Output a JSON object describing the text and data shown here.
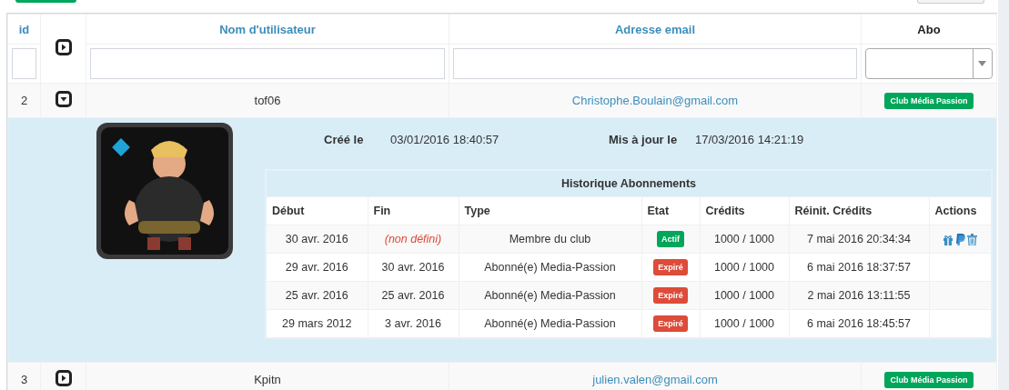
{
  "table": {
    "columns": [
      {
        "label": "id",
        "sortable": true,
        "kind": "text"
      },
      {
        "kind": "toggle"
      },
      {
        "label": "Nom d'utilisateur",
        "sortable": true,
        "kind": "text"
      },
      {
        "label": "Adresse email",
        "sortable": true,
        "kind": "text"
      },
      {
        "label": "Abo",
        "sortable": false,
        "kind": "select"
      }
    ],
    "toggle_all_expanded": false,
    "rows": [
      {
        "id": "2",
        "expanded": true,
        "username": "tof06",
        "email": "Christophe.Boulain@gmail.com",
        "abo": "Club Média Passion",
        "detail": {
          "created_label": "Créé le",
          "created": "03/01/2016 18:40:57",
          "updated_label": "Mis à jour le",
          "updated": "17/03/2016 14:21:19",
          "history": {
            "title": "Historique Abonnements",
            "columns": [
              "Début",
              "Fin",
              "Type",
              "Etat",
              "Crédits",
              "Réinit. Crédits",
              "Actions"
            ],
            "rows": [
              {
                "start": "30 avr. 2016",
                "end": "(non défini)",
                "end_missing": true,
                "type": "Membre du club",
                "status": "Actif",
                "color": "#00a65a",
                "credits": "1000 / 1000",
                "reset": "7 mai 2016 20:34:34",
                "actions": true
              },
              {
                "start": "29 avr. 2016",
                "end": "30 avr. 2016",
                "end_missing": false,
                "type": "Abonné(e) Media-Passion",
                "status": "Expiré",
                "color": "#dd4b39",
                "credits": "1000 / 1000",
                "reset": "6 mai 2016 18:37:57",
                "actions": false
              },
              {
                "start": "25 avr. 2016",
                "end": "25 avr. 2016",
                "end_missing": false,
                "type": "Abonné(e) Media-Passion",
                "status": "Expiré",
                "color": "#dd4b39",
                "credits": "1000 / 1000",
                "reset": "2 mai 2016 13:11:55",
                "actions": false
              },
              {
                "start": "29 mars 2012",
                "end": "3 avr. 2016",
                "end_missing": false,
                "type": "Abonné(e) Media-Passion",
                "status": "Expiré",
                "color": "#dd4b39",
                "credits": "1000 / 1000",
                "reset": "6 mai 2016 18:45:57",
                "actions": false
              }
            ]
          }
        }
      },
      {
        "id": "3",
        "expanded": false,
        "username": "Kpitn",
        "email": "julien.valen@gmail.com",
        "abo": "Club Média Passion"
      }
    ]
  }
}
